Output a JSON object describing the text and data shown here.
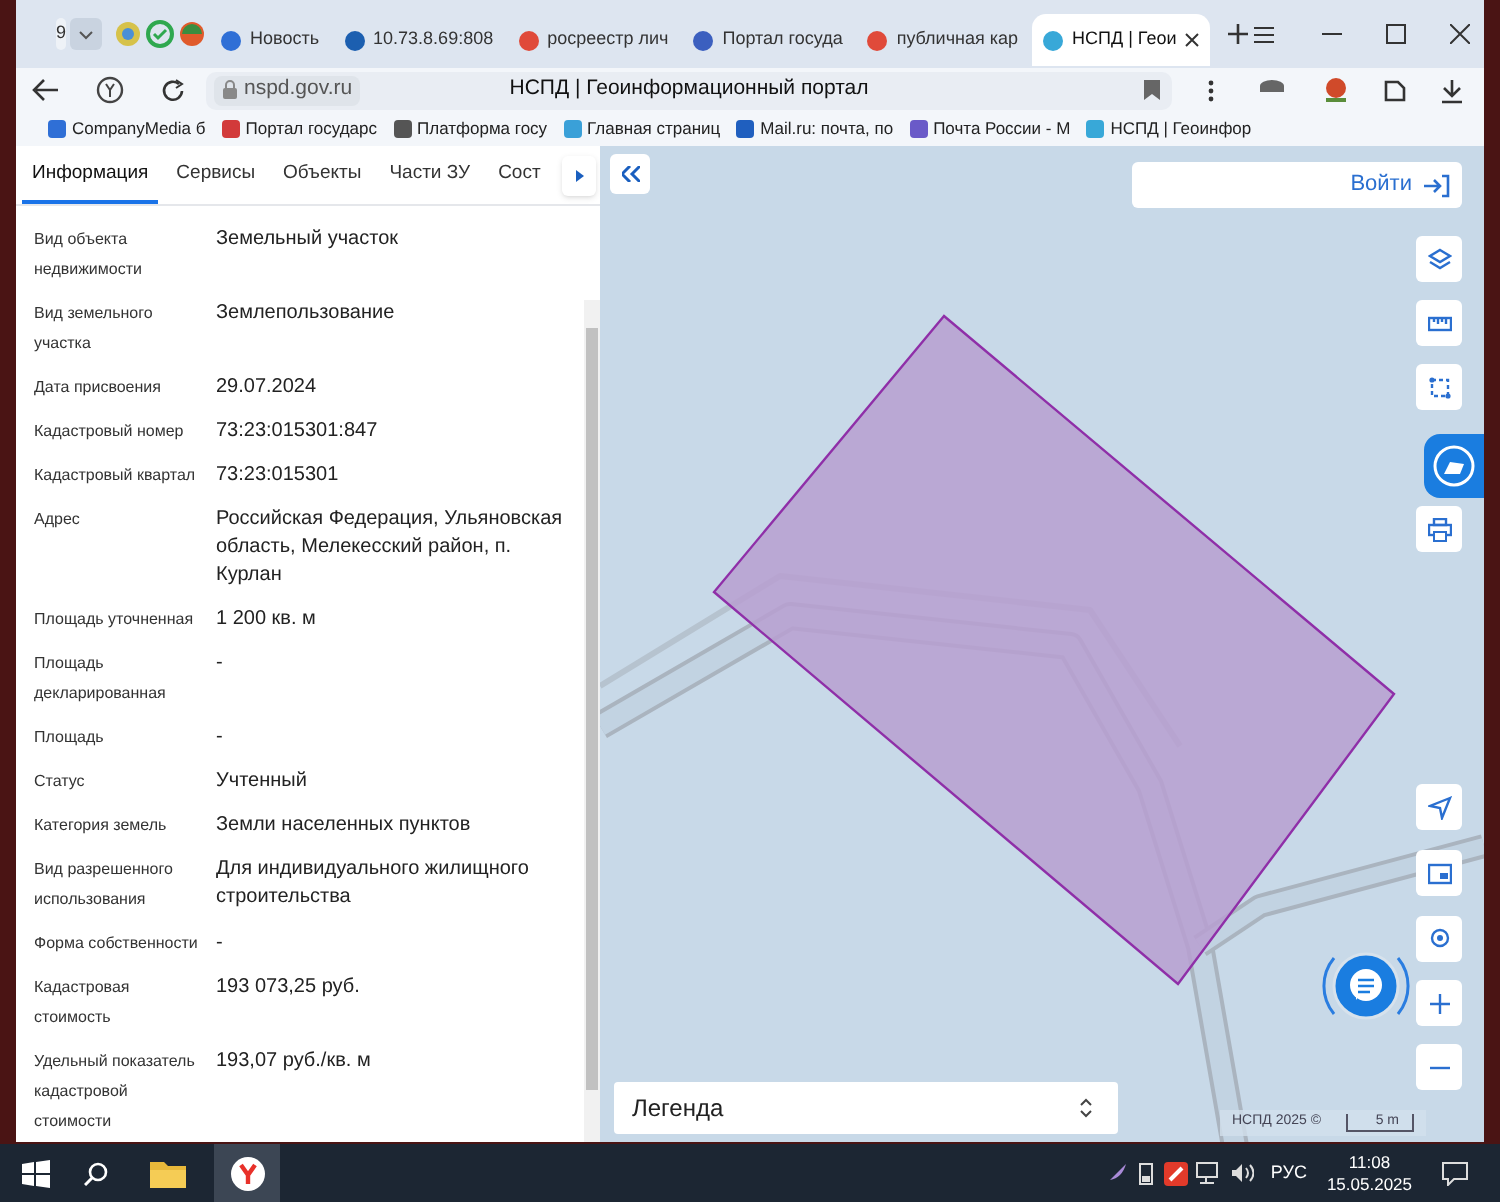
{
  "browser": {
    "tab_counter": "9",
    "tabs": [
      {
        "kind": "icon",
        "selected": false
      },
      {
        "kind": "icon",
        "selected": false
      },
      {
        "kind": "icon",
        "selected": false
      },
      {
        "kind": "page",
        "title": "Новость",
        "selected": false
      },
      {
        "kind": "page",
        "title": "10.73.8.69:808",
        "selected": false
      },
      {
        "kind": "page",
        "title": "росреестр лич",
        "selected": false
      },
      {
        "kind": "page",
        "title": "Портал госуда",
        "selected": false
      },
      {
        "kind": "page",
        "title": "публичная кар",
        "selected": false
      },
      {
        "kind": "page",
        "title": "НСПД | Геои",
        "selected": true
      }
    ],
    "address": "nspd.gov.ru",
    "page_title": "НСПД | Геоинформационный портал",
    "bookmarks": [
      "CompanyMedia б",
      "Портал государс",
      "Платформа госу",
      "Главная страниц",
      "Mail.ru: почта, по",
      "Почта России - М",
      "НСПД | Геоинфор"
    ]
  },
  "panel": {
    "tabs": [
      {
        "label": "Информация",
        "selected": true
      },
      {
        "label": "Сервисы",
        "selected": false
      },
      {
        "label": "Объекты",
        "selected": false
      },
      {
        "label": "Части ЗУ",
        "selected": false
      },
      {
        "label": "Сост",
        "selected": false
      }
    ],
    "rows": [
      {
        "label": "Вид объекта недвижимости",
        "value": "Земельный участок"
      },
      {
        "label": "Вид земельного участка",
        "value": "Землепользование"
      },
      {
        "label": "Дата присвоения",
        "value": "29.07.2024"
      },
      {
        "label": "Кадастровый номер",
        "value": "73:23:015301:847"
      },
      {
        "label": "Кадастровый квартал",
        "value": "73:23:015301"
      },
      {
        "label": "Адрес",
        "value": "Российская Федерация, Ульяновская область, Мелекесский район, п. Курлан"
      },
      {
        "label": "Площадь уточненная",
        "value": "1 200 кв. м"
      },
      {
        "label": "Площадь декларированная",
        "value": "-"
      },
      {
        "label": "Площадь",
        "value": "-"
      },
      {
        "label": "Статус",
        "value": "Учтенный"
      },
      {
        "label": "Категория земель",
        "value": "Земли населенных пунктов"
      },
      {
        "label": "Вид разрешенного использования",
        "value": "Для индивидуального жилищного строительства"
      },
      {
        "label": "Форма собственности",
        "value": "-"
      },
      {
        "label": "Кадастровая стоимость",
        "value": "193 073,25 руб."
      },
      {
        "label": "Удельный показатель кадастровой стоимости",
        "value": "193,07 руб./кв. м"
      }
    ]
  },
  "map": {
    "login": "Войти",
    "legend": "Легенда",
    "copyright": "НСПД 2025 ©",
    "scale": "5 m"
  },
  "taskbar": {
    "language": "РУС",
    "time": "11:08",
    "date": "15.05.2025"
  }
}
